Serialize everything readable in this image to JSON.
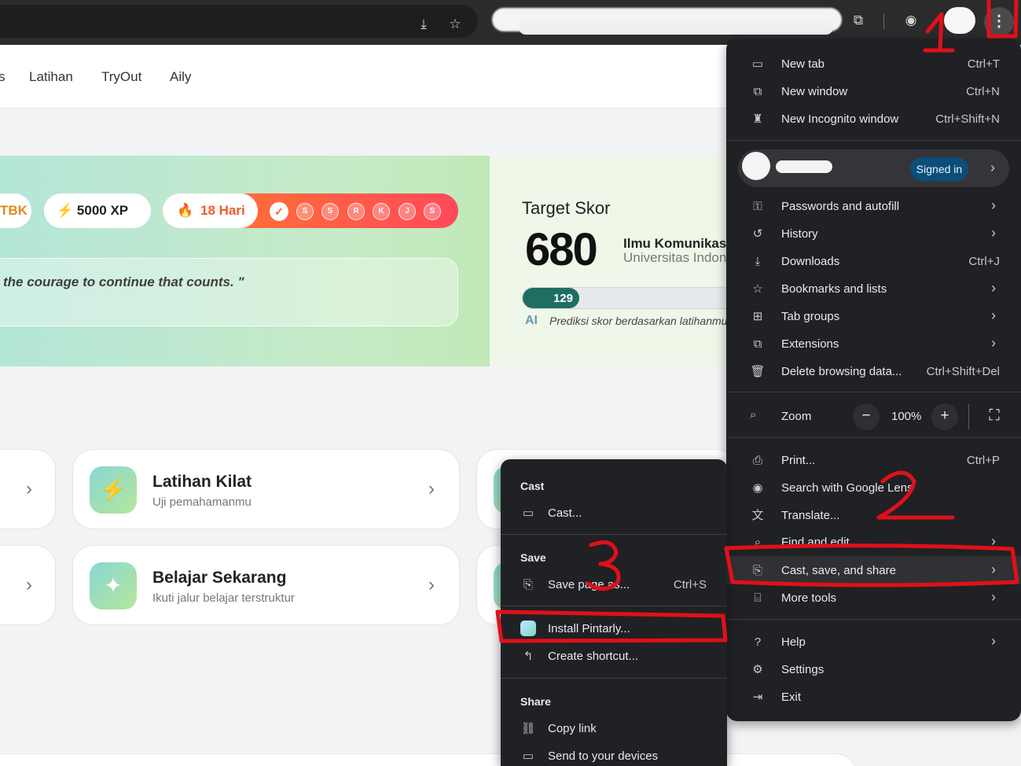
{
  "toolbar": {
    "icons": [
      "install-app-icon",
      "star-icon",
      "extensions-icon",
      "lens-icon",
      "kebab-menu-icon"
    ]
  },
  "nav": {
    "partial": "s",
    "items": [
      "Latihan",
      "TryOut",
      "Aily"
    ]
  },
  "stats": {
    "exam_partial": "TBK",
    "xp": "5000 XP",
    "streak": "18 Hari",
    "days": [
      "S",
      "S",
      "R",
      "K",
      "J",
      "S"
    ]
  },
  "quote": "the courage to continue that counts. \"",
  "target": {
    "title": "Target Skor",
    "score": "680",
    "major": "Ilmu Komunikasi",
    "university": "Universitas Indonesia",
    "progress_value": "129",
    "progress_fraction": 0.25,
    "ai_label": "AI",
    "ai_note": "Prediksi skor berdasarkan latihanmu"
  },
  "cards": [
    {
      "title": "Latihan Kilat",
      "subtitle": "Uji pemahamanmu",
      "icon": "bolt-icon"
    },
    {
      "title": "Belajar Sekarang",
      "subtitle": "Ikuti jalur belajar terstruktur",
      "icon": "sparkle-icon"
    }
  ],
  "menu": {
    "new_tab": {
      "label": "New tab",
      "shortcut": "Ctrl+T"
    },
    "new_window": {
      "label": "New window",
      "shortcut": "Ctrl+N"
    },
    "new_incognito": {
      "label": "New Incognito window",
      "shortcut": "Ctrl+Shift+N"
    },
    "signed_in": "Signed in",
    "passwords": "Passwords and autofill",
    "history": "History",
    "downloads": {
      "label": "Downloads",
      "shortcut": "Ctrl+J"
    },
    "bookmarks": "Bookmarks and lists",
    "tab_groups": "Tab groups",
    "extensions": "Extensions",
    "delete_data": {
      "label": "Delete browsing data...",
      "shortcut": "Ctrl+Shift+Del"
    },
    "zoom": {
      "label": "Zoom",
      "value": "100%",
      "minus": "−",
      "plus": "+"
    },
    "print": {
      "label": "Print...",
      "shortcut": "Ctrl+P"
    },
    "lens": "Search with Google Lens",
    "translate": "Translate...",
    "find_edit": "Find and edit",
    "cast_save_share": "Cast, save, and share",
    "more_tools": "More tools",
    "help": "Help",
    "settings": "Settings",
    "exit": "Exit"
  },
  "submenu": {
    "cast_header": "Cast",
    "cast": "Cast...",
    "save_header": "Save",
    "save_page": {
      "label": "Save page as...",
      "shortcut": "Ctrl+S"
    },
    "install": "Install Pintarly...",
    "create_shortcut": "Create shortcut...",
    "share_header": "Share",
    "copy_link": "Copy link",
    "send_devices": "Send to your devices"
  },
  "annotations": {
    "one": "1",
    "two": "2",
    "three": "3",
    "color": "#e0101a"
  }
}
